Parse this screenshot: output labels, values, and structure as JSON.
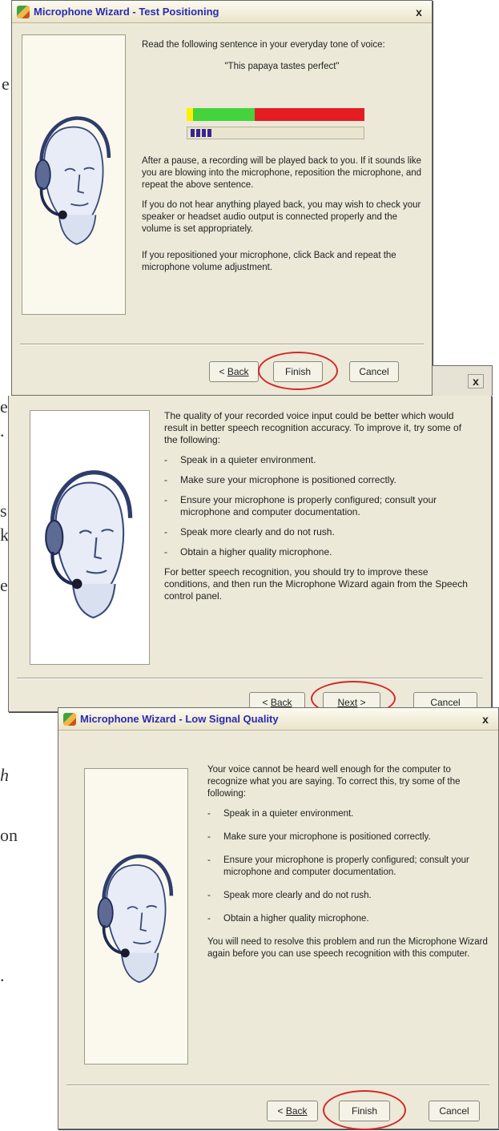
{
  "background_fragments": [
    "e",
    "e",
    ".",
    "s",
    "k",
    "e",
    "h",
    "on",
    "."
  ],
  "dialog1": {
    "title": "Microphone Wizard - Test Positioning",
    "close": "x",
    "instruction": "Read the following sentence in your everyday tone of voice:",
    "sentence": "\"This papaya tastes perfect\"",
    "level_meter": {
      "level": 0.18
    },
    "para1": "After a pause, a recording will be played back to you. If it sounds like you are blowing into the microphone, reposition the microphone, and repeat the above sentence.",
    "para2": "If you do not hear anything played back, you may wish to check your speaker or headset audio output is connected properly and the volume is set appropriately.",
    "para3": "If you repositioned your microphone, click Back and repeat the microphone volume adjustment.",
    "buttons": {
      "back": "Back",
      "back_prefix": "< ",
      "finish": "Finish",
      "cancel": "Cancel"
    }
  },
  "dialog2": {
    "close": "x",
    "intro": "The quality of your recorded voice input could be better which would result in better speech recognition accuracy. To improve it, try some of the following:",
    "tips": [
      "Speak in a quieter environment.",
      "Make sure your microphone is positioned correctly.",
      "Ensure your microphone is properly configured;  consult your microphone and computer documentation.",
      "Speak more clearly and do not rush.",
      "Obtain a higher quality microphone."
    ],
    "outro": "For better speech recognition, you should try to improve these conditions, and then run the Microphone Wizard again from the Speech control panel.",
    "buttons": {
      "back": "Back",
      "back_prefix": "< ",
      "next": "Next",
      "next_suffix": " >",
      "cancel": "Cancel"
    }
  },
  "dialog3": {
    "title": "Microphone Wizard - Low Signal Quality",
    "close": "x",
    "intro": "Your voice cannot be heard well enough for the computer to recognize what you are saying. To correct this, try some of the following:",
    "tips": [
      "Speak in a quieter environment.",
      "Make sure your microphone is positioned correctly.",
      "Ensure your microphone is properly configured;  consult your microphone and computer documentation.",
      "Speak more clearly and do not rush.",
      "Obtain a higher quality microphone."
    ],
    "outro": "You will need to resolve this problem and run the Microphone Wizard again before you can use speech recognition with this computer.",
    "buttons": {
      "back": "Back",
      "back_prefix": "< ",
      "finish": "Finish",
      "cancel": "Cancel"
    }
  },
  "colors": {
    "highlight_circle": "#d6262b",
    "dialog_bg": "#ece9d8",
    "title_text": "#2a2ab0"
  },
  "icons": [
    "wizard-icon",
    "close-icon",
    "headset-head-icon"
  ]
}
